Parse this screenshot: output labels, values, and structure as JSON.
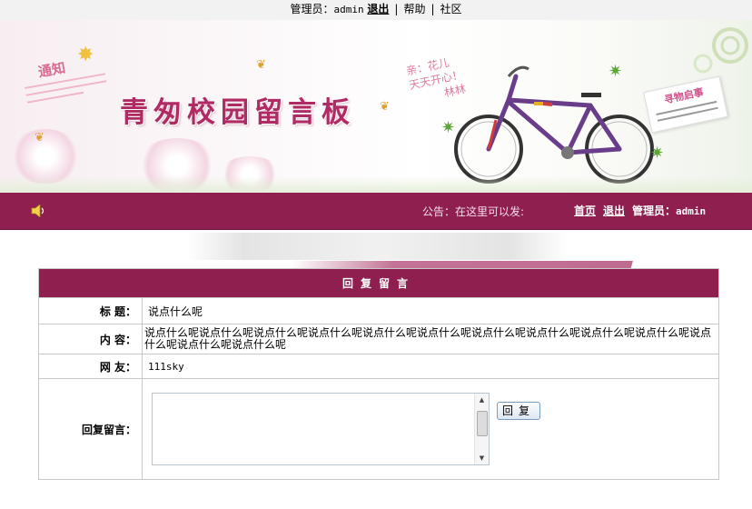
{
  "topbar": {
    "admin_label": "管理员：",
    "admin_name": "admin",
    "logout": "退出",
    "help": "帮助",
    "community": "社区"
  },
  "banner": {
    "site_title": "青匆校园留言板",
    "notice_heading": "通知",
    "poem": [
      "亲：花儿",
      "天天开心！",
      "林林"
    ],
    "lost_found": "寻物启事",
    "icons": [
      "butterfly-icon",
      "bicycle-icon",
      "maple-leaf-icon"
    ]
  },
  "navbar": {
    "announcement": "公告：在这里可以发:",
    "home": "首页",
    "logout": "退出",
    "admin_label": "管理员：",
    "admin_name": "admin",
    "accent_color": "#8e1f4f"
  },
  "reply_form": {
    "header": "回复留言",
    "title_label": "标  题：",
    "title_value": "说点什么呢",
    "content_label": "内  容：",
    "content_value": "说点什么呢说点什么呢说点什么呢说点什么呢说点什么呢说点什么呢说点什么呢说点什么呢说点什么呢说点什么呢说点什么呢说点什么呢说点什么呢",
    "user_label": "网  友：",
    "user_value": "111sky",
    "reply_label": "回复留言：",
    "reply_value": "",
    "submit_label": "回复"
  }
}
